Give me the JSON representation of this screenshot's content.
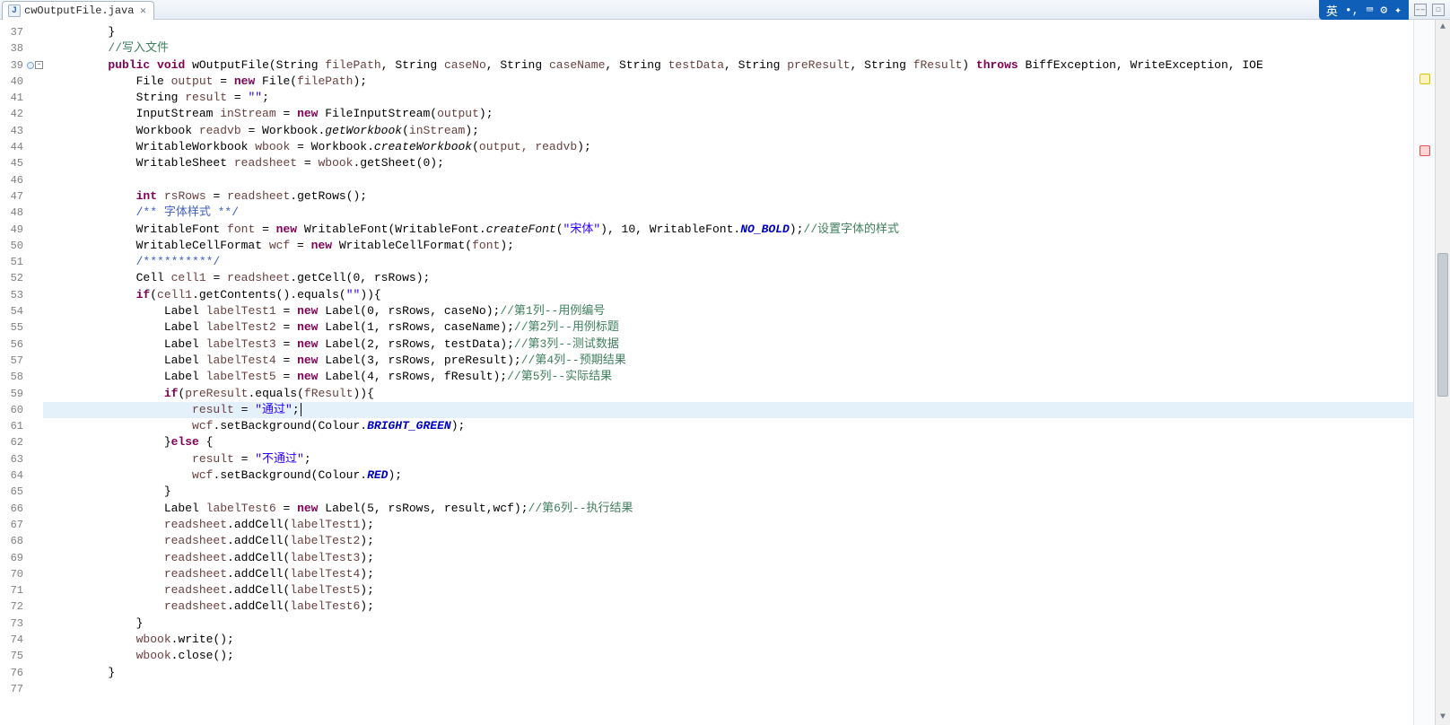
{
  "tab": {
    "filename": "cwOutputFile.java"
  },
  "lines": {
    "start": 37,
    "end": 77,
    "highlighted": 60,
    "fold_marker_line": 39
  },
  "code": {
    "l37": "        }",
    "l38_cmt": "//写入文件",
    "l39": {
      "kw_public": "public",
      "kw_void": "void",
      "m": "wOutputFile",
      "p1t": "String",
      "p1v": "filePath",
      "p2t": "String",
      "p2v": "caseNo",
      "p3t": "String",
      "p3v": "caseName",
      "p4t": "String",
      "p4v": "testData",
      "p5t": "String",
      "p5v": "preResult",
      "p6t": "String",
      "p6v": "fResult",
      "kw_throws": "throws",
      "ex": "BiffException, WriteException, IOE"
    },
    "l40": {
      "t": "File",
      "v": "output",
      "kw_new": "new",
      "c": "File",
      "a": "filePath"
    },
    "l41": {
      "t": "String",
      "v": "result",
      "str": "\"\""
    },
    "l42": {
      "t": "InputStream",
      "v": "inStream",
      "kw_new": "new",
      "c": "FileInputStream",
      "a": "output"
    },
    "l43": {
      "t": "Workbook",
      "v": "readvb",
      "call": "Workbook",
      "m": "getWorkbook",
      "a": "inStream"
    },
    "l44": {
      "t": "WritableWorkbook",
      "v": "wbook",
      "call": "Workbook",
      "m": "createWorkbook",
      "a": "output, readvb"
    },
    "l45": {
      "t": "WritableSheet",
      "v": "readsheet",
      "obj": "wbook",
      "m": "getSheet",
      "a": "0"
    },
    "l47": {
      "kw": "int",
      "v": "rsRows",
      "obj": "readsheet",
      "m": "getRows"
    },
    "l48_doc": "/** 字体样式 **/",
    "l49": {
      "t": "WritableFont",
      "v": "font",
      "kw_new": "new",
      "c": "WritableFont",
      "inner": "WritableFont",
      "im": "createFont",
      "str": "\"宋体\"",
      "n": "10",
      "cls": "WritableFont",
      "sf": "NO_BOLD",
      "cmt": "//设置字体的样式"
    },
    "l50": {
      "t": "WritableCellFormat",
      "v": "wcf",
      "kw_new": "new",
      "c": "WritableCellFormat",
      "a": "font"
    },
    "l51_cmt": "/**********/",
    "l52": {
      "t": "Cell",
      "v": "cell1",
      "obj": "readsheet",
      "m": "getCell",
      "a": "0, rsRows"
    },
    "l53": {
      "kw_if": "if",
      "obj": "cell1",
      "m1": "getContents",
      "m2": "equals",
      "str": "\"\""
    },
    "l54": {
      "t": "Label",
      "v": "labelTest1",
      "kw_new": "new",
      "c": "Label",
      "a": "0, rsRows, caseNo",
      "cmt": "//第1列--用例编号"
    },
    "l55": {
      "t": "Label",
      "v": "labelTest2",
      "kw_new": "new",
      "c": "Label",
      "a": "1, rsRows, caseName",
      "cmt": "//第2列--用例标题"
    },
    "l56": {
      "t": "Label",
      "v": "labelTest3",
      "kw_new": "new",
      "c": "Label",
      "a": "2, rsRows, testData",
      "cmt": "//第3列--测试数据"
    },
    "l57": {
      "t": "Label",
      "v": "labelTest4",
      "kw_new": "new",
      "c": "Label",
      "a": "3, rsRows, preResult",
      "cmt": "//第4列--预期结果"
    },
    "l58": {
      "t": "Label",
      "v": "labelTest5",
      "kw_new": "new",
      "c": "Label",
      "a": "4, rsRows, fResult",
      "cmt": "//第5列--实际结果"
    },
    "l59": {
      "kw_if": "if",
      "obj": "preResult",
      "m": "equals",
      "a": "fResult"
    },
    "l60": {
      "v": "result",
      "str": "\"通过\""
    },
    "l61": {
      "obj": "wcf",
      "m": "setBackground",
      "cls": "Colour",
      "sf": "BRIGHT_GREEN"
    },
    "l62": {
      "kw_else": "else"
    },
    "l63": {
      "v": "result",
      "str": "\"不通过\""
    },
    "l64": {
      "obj": "wcf",
      "m": "setBackground",
      "cls": "Colour",
      "sf": "RED"
    },
    "l66": {
      "t": "Label",
      "v": "labelTest6",
      "kw_new": "new",
      "c": "Label",
      "a": "5, rsRows, result,wcf",
      "cmt": "//第6列--执行结果"
    },
    "l67": {
      "obj": "readsheet",
      "m": "addCell",
      "a": "labelTest1"
    },
    "l68": {
      "obj": "readsheet",
      "m": "addCell",
      "a": "labelTest2"
    },
    "l69": {
      "obj": "readsheet",
      "m": "addCell",
      "a": "labelTest3"
    },
    "l70": {
      "obj": "readsheet",
      "m": "addCell",
      "a": "labelTest4"
    },
    "l71": {
      "obj": "readsheet",
      "m": "addCell",
      "a": "labelTest5"
    },
    "l72": {
      "obj": "readsheet",
      "m": "addCell",
      "a": "labelTest6"
    },
    "l74": {
      "obj": "wbook",
      "m": "write"
    },
    "l75": {
      "obj": "wbook",
      "m": "close"
    }
  }
}
